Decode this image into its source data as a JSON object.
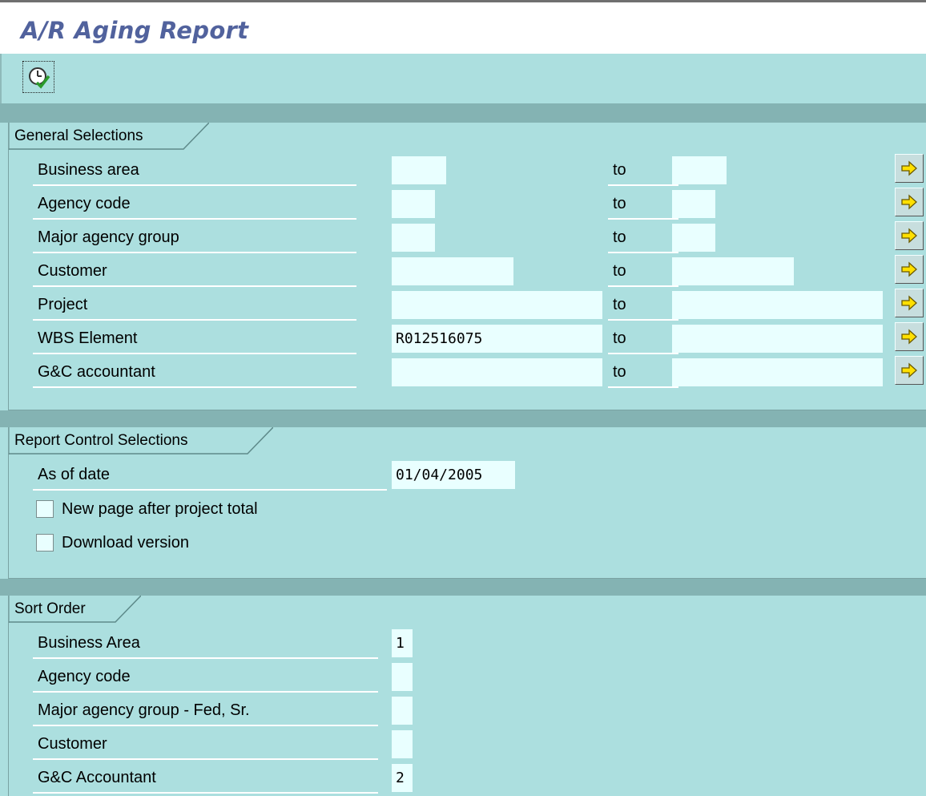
{
  "title": "A/R Aging Report",
  "toolbar": {
    "execute_icon": "execute-clock-check-icon"
  },
  "general": {
    "heading": "General Selections",
    "to_label": "to",
    "rows": [
      {
        "label": "Business area",
        "from": "",
        "to": ""
      },
      {
        "label": "Agency code",
        "from": "",
        "to": ""
      },
      {
        "label": "Major agency group",
        "from": "",
        "to": ""
      },
      {
        "label": "Customer",
        "from": "",
        "to": ""
      },
      {
        "label": "Project",
        "from": "",
        "to": ""
      },
      {
        "label": "WBS Element",
        "from": "R012516075",
        "to": ""
      },
      {
        "label": "G&C accountant",
        "from": "",
        "to": ""
      }
    ]
  },
  "report_control": {
    "heading": "Report Control Selections",
    "as_of_date_label": "As of date",
    "as_of_date": "01/04/2005",
    "new_page_label": "New page after project total",
    "new_page_checked": false,
    "download_label": "Download version",
    "download_checked": false
  },
  "sort_order": {
    "heading": "Sort Order",
    "rows": [
      {
        "label": "Business Area",
        "value": "1"
      },
      {
        "label": "Agency code",
        "value": ""
      },
      {
        "label": "Major agency group - Fed, Sr.",
        "value": ""
      },
      {
        "label": "Customer",
        "value": ""
      },
      {
        "label": "G&C Accountant",
        "value": "2"
      }
    ]
  },
  "colors": {
    "background": "#acdfdf",
    "title": "#51629d",
    "field": "#e9ffff",
    "separator": "#84b3b3",
    "arrow": "#ffe000"
  }
}
